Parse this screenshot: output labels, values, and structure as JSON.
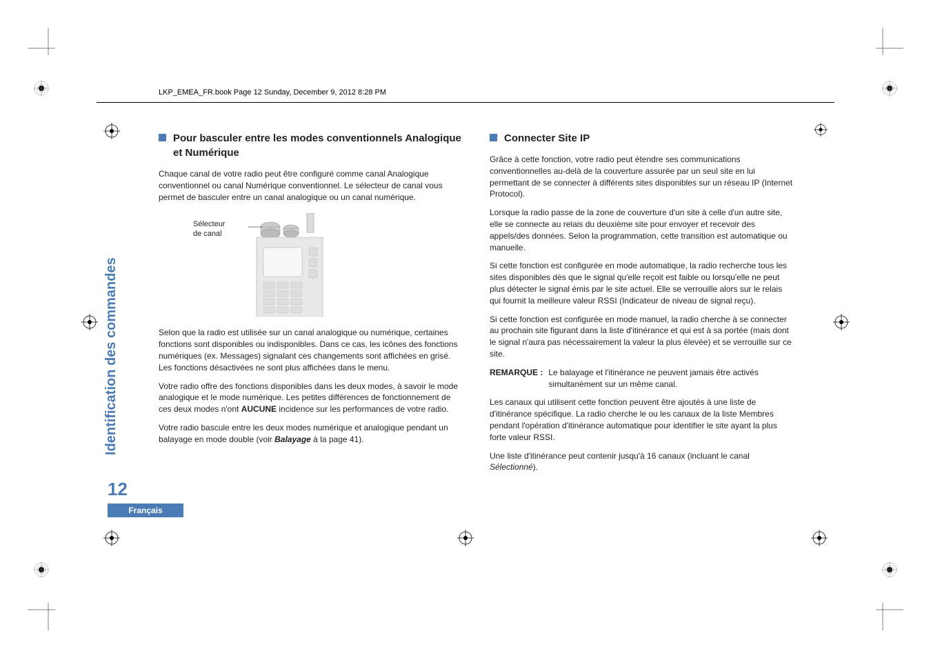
{
  "book_info": "LKP_EMEA_FR.book  Page 12  Sunday, December 9, 2012  8:28 PM",
  "sidebar_title": "Identification des commandes",
  "page_number": "12",
  "lang_footer": "Français",
  "left": {
    "heading": "Pour basculer entre les modes conventionnels Analogique et Numérique",
    "p1": "Chaque canal de votre radio peut être configuré comme canal Analogique conventionnel ou canal Numérique conventionnel. Le sélecteur de canal vous permet de basculer entre un canal analogique ou un canal numérique.",
    "image_label1": "Sélecteur",
    "image_label2": "de canal",
    "p2": "Selon que la radio est utilisée sur un canal analogique ou numérique, certaines fonctions sont disponibles ou indisponibles. Dans ce cas, les icônes des fonctions numériques (ex. Messages) signalant ces changements sont affichées en grisé. Les fonctions désactivées ne sont plus affichées dans le menu.",
    "p3a": "Votre radio offre des fonctions disponibles dans les deux modes, à savoir le mode analogique et le mode numérique. Les petites différences de fonctionnement de ces deux modes n'ont ",
    "p3b": "AUCUNE",
    "p3c": " incidence sur les performances de votre radio.",
    "p4a": "Votre radio bascule entre les deux modes numérique et analogique pendant un balayage en mode double (voir ",
    "p4b": "Balayage",
    "p4c": " à la page 41)."
  },
  "right": {
    "heading": "Connecter Site IP",
    "p1": "Grâce à cette fonction, votre radio peut étendre ses communications conventionnelles au-delà de la couverture assurée par un seul site en lui permettant de se connecter à différents sites disponibles sur un réseau IP (Internet Protocol).",
    "p2": "Lorsque la radio passe de la zone de couverture d'un site à celle d'un autre site, elle se connecte au relais du deuxième site pour envoyer et recevoir des appels/des données. Selon la programmation, cette transition est automatique ou manuelle.",
    "p3": "Si cette fonction est configurée en mode automatique, la radio recherche tous les sites disponibles dès que le signal qu'elle reçoit est faible ou lorsqu'elle ne peut plus détecter le signal émis par le site actuel. Elle se verrouille alors sur le relais qui fournit la meilleure valeur RSSI (Indicateur de niveau de signal reçu).",
    "p4": "Si cette fonction est configurée en mode manuel, la radio cherche à se connecter au prochain site figurant dans la liste d'itinérance et qui est à sa portée (mais dont le signal n'aura pas nécessairement la valeur la plus élevée) et se verrouille sur ce site.",
    "remark_label": "REMARQUE :",
    "remark_text": "Le balayage et l'itinérance ne peuvent jamais être activés simultanément sur un même canal.",
    "p5": "Les canaux qui utilisent cette fonction peuvent être ajoutés à une liste de d'itinérance spécifique. La radio cherche le ou les canaux de la liste Membres pendant l'opération d'itinérance automatique pour identifier le site ayant la plus forte valeur RSSI.",
    "p6a": "Une liste d'itinérance peut contenir jusqu'à 16 canaux (incluant le canal ",
    "p6b": "Sélectionné",
    "p6c": ")."
  }
}
